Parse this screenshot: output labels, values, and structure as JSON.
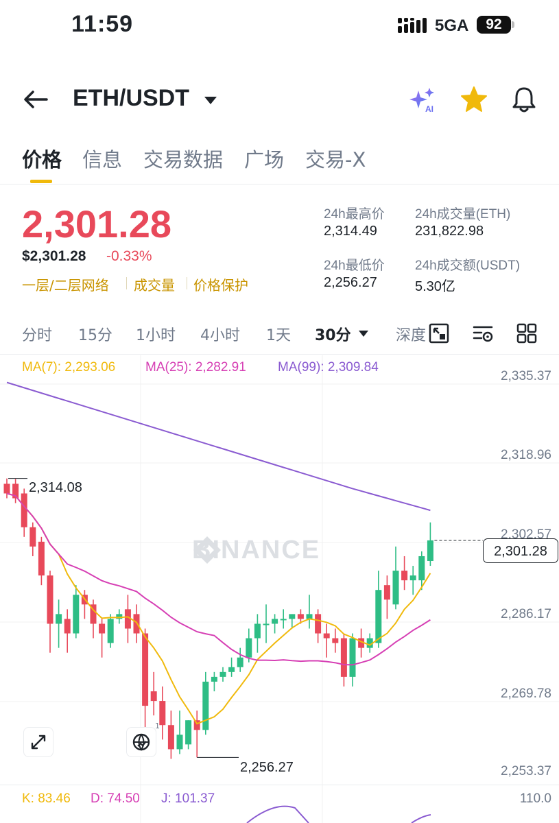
{
  "status": {
    "time": "11:59",
    "network": "5GA",
    "battery": "92"
  },
  "header": {
    "pair": "ETH/USDT",
    "ai_badge": "AI"
  },
  "tabs": [
    "价格",
    "信息",
    "交易数据",
    "广场",
    "交易-X"
  ],
  "price": {
    "last": "2,301.28",
    "usd": "$2,301.28",
    "change": "-0.33%",
    "tags": [
      "一层/二层网络",
      "成交量",
      "价格保护"
    ]
  },
  "stats": {
    "high_label": "24h最高价",
    "high": "2,314.49",
    "vol_label": "24h成交量(ETH)",
    "vol": "231,822.98",
    "low_label": "24h最低价",
    "low": "2,256.27",
    "amount_label": "24h成交额(USDT)",
    "amount": "5.30亿"
  },
  "intervals": [
    "分时",
    "15分",
    "1小时",
    "4小时",
    "1天",
    "30分",
    "深度"
  ],
  "chart_meta": {
    "ma7": "MA(7): 2,293.06",
    "ma25": "MA(25): 2,282.91",
    "ma99": "MA(99): 2,309.84",
    "colors": {
      "up": "#2ebd85",
      "down": "#e8495a",
      "ma7": "#f0b90b",
      "ma25": "#d63fb4",
      "ma99": "#8a5bd1"
    },
    "current_price": "2,301.28",
    "high_ann": "2,314.08",
    "low_ann": "2,256.27",
    "watermark": "BINANCE",
    "globe_badge": "1",
    "y_labels": [
      "2,335.37",
      "2,318.96",
      "2,302.57",
      "2,286.17",
      "2,269.78",
      "2,253.37"
    ]
  },
  "kdj": {
    "k": "K: 83.46",
    "d": "D: 74.50",
    "j": "J: 101.37",
    "max": "110.0"
  },
  "chart_data": {
    "type": "candlestick",
    "interval": "30分",
    "ylim": [
      2253.37,
      2335.37
    ],
    "candles": [
      {
        "o": 2313.0,
        "h": 2314.1,
        "l": 2310.0,
        "c": 2311.0
      },
      {
        "o": 2313.0,
        "h": 2314.0,
        "l": 2309.0,
        "c": 2310.0
      },
      {
        "o": 2311.0,
        "h": 2312.0,
        "l": 2302.0,
        "c": 2304.0
      },
      {
        "o": 2304.0,
        "h": 2305.0,
        "l": 2298.0,
        "c": 2300.0
      },
      {
        "o": 2301.0,
        "h": 2302.0,
        "l": 2292.0,
        "c": 2294.0
      },
      {
        "o": 2294.0,
        "h": 2295.0,
        "l": 2278.0,
        "c": 2284.0
      },
      {
        "o": 2284.0,
        "h": 2289.0,
        "l": 2279.0,
        "c": 2286.0
      },
      {
        "o": 2285.0,
        "h": 2287.0,
        "l": 2278.0,
        "c": 2282.0
      },
      {
        "o": 2282.0,
        "h": 2292.0,
        "l": 2281.0,
        "c": 2290.0
      },
      {
        "o": 2290.0,
        "h": 2291.0,
        "l": 2285.0,
        "c": 2288.0
      },
      {
        "o": 2288.0,
        "h": 2289.0,
        "l": 2281.0,
        "c": 2284.0
      },
      {
        "o": 2284.0,
        "h": 2285.0,
        "l": 2277.0,
        "c": 2282.0
      },
      {
        "o": 2280.0,
        "h": 2286.0,
        "l": 2279.0,
        "c": 2285.0
      },
      {
        "o": 2285.0,
        "h": 2287.0,
        "l": 2284.0,
        "c": 2286.0
      },
      {
        "o": 2287.0,
        "h": 2290.0,
        "l": 2280.0,
        "c": 2283.0
      },
      {
        "o": 2286.0,
        "h": 2288.0,
        "l": 2280.0,
        "c": 2282.0
      },
      {
        "o": 2282.0,
        "h": 2283.0,
        "l": 2258.0,
        "c": 2267.0
      },
      {
        "o": 2270.0,
        "h": 2274.0,
        "l": 2265.0,
        "c": 2268.0
      },
      {
        "o": 2268.0,
        "h": 2271.0,
        "l": 2260.0,
        "c": 2263.0
      },
      {
        "o": 2263.0,
        "h": 2266.0,
        "l": 2256.0,
        "c": 2258.0
      },
      {
        "o": 2258.0,
        "h": 2266.0,
        "l": 2257.0,
        "c": 2261.0
      },
      {
        "o": 2259.0,
        "h": 2264.0,
        "l": 2258.0,
        "c": 2264.0
      },
      {
        "o": 2264.0,
        "h": 2266.0,
        "l": 2256.3,
        "c": 2262.0
      },
      {
        "o": 2262.0,
        "h": 2274.0,
        "l": 2261.0,
        "c": 2272.0
      },
      {
        "o": 2272.0,
        "h": 2274.0,
        "l": 2270.0,
        "c": 2273.0
      },
      {
        "o": 2273.0,
        "h": 2275.0,
        "l": 2272.0,
        "c": 2274.0
      },
      {
        "o": 2274.0,
        "h": 2277.0,
        "l": 2273.0,
        "c": 2275.0
      },
      {
        "o": 2275.0,
        "h": 2279.0,
        "l": 2274.0,
        "c": 2277.0
      },
      {
        "o": 2277.0,
        "h": 2283.0,
        "l": 2276.0,
        "c": 2281.0
      },
      {
        "o": 2281.0,
        "h": 2286.0,
        "l": 2278.0,
        "c": 2284.0
      },
      {
        "o": 2284.0,
        "h": 2288.0,
        "l": 2280.0,
        "c": 2284.0
      },
      {
        "o": 2284.0,
        "h": 2286.0,
        "l": 2282.0,
        "c": 2285.0
      },
      {
        "o": 2285.0,
        "h": 2287.0,
        "l": 2283.0,
        "c": 2285.0
      },
      {
        "o": 2285.0,
        "h": 2286.0,
        "l": 2283.0,
        "c": 2286.0
      },
      {
        "o": 2286.0,
        "h": 2287.0,
        "l": 2284.0,
        "c": 2285.0
      },
      {
        "o": 2285.0,
        "h": 2290.0,
        "l": 2283.0,
        "c": 2286.0
      },
      {
        "o": 2286.0,
        "h": 2287.0,
        "l": 2280.0,
        "c": 2282.0
      },
      {
        "o": 2282.0,
        "h": 2284.0,
        "l": 2277.0,
        "c": 2281.0
      },
      {
        "o": 2281.0,
        "h": 2283.0,
        "l": 2278.0,
        "c": 2280.0
      },
      {
        "o": 2281.0,
        "h": 2282.0,
        "l": 2271.0,
        "c": 2273.0
      },
      {
        "o": 2273.0,
        "h": 2282.0,
        "l": 2271.0,
        "c": 2281.0
      },
      {
        "o": 2281.0,
        "h": 2283.0,
        "l": 2277.0,
        "c": 2279.0
      },
      {
        "o": 2279.0,
        "h": 2282.0,
        "l": 2278.0,
        "c": 2281.0
      },
      {
        "o": 2280.0,
        "h": 2295.0,
        "l": 2279.0,
        "c": 2291.0
      },
      {
        "o": 2292.0,
        "h": 2294.0,
        "l": 2285.0,
        "c": 2289.0
      },
      {
        "o": 2288.0,
        "h": 2300.0,
        "l": 2287.0,
        "c": 2295.0
      },
      {
        "o": 2295.0,
        "h": 2298.0,
        "l": 2291.0,
        "c": 2293.0
      },
      {
        "o": 2293.0,
        "h": 2296.0,
        "l": 2290.0,
        "c": 2294.0
      },
      {
        "o": 2293.0,
        "h": 2299.0,
        "l": 2291.0,
        "c": 2298.0
      },
      {
        "o": 2297.0,
        "h": 2305.0,
        "l": 2296.0,
        "c": 2301.28
      }
    ]
  }
}
